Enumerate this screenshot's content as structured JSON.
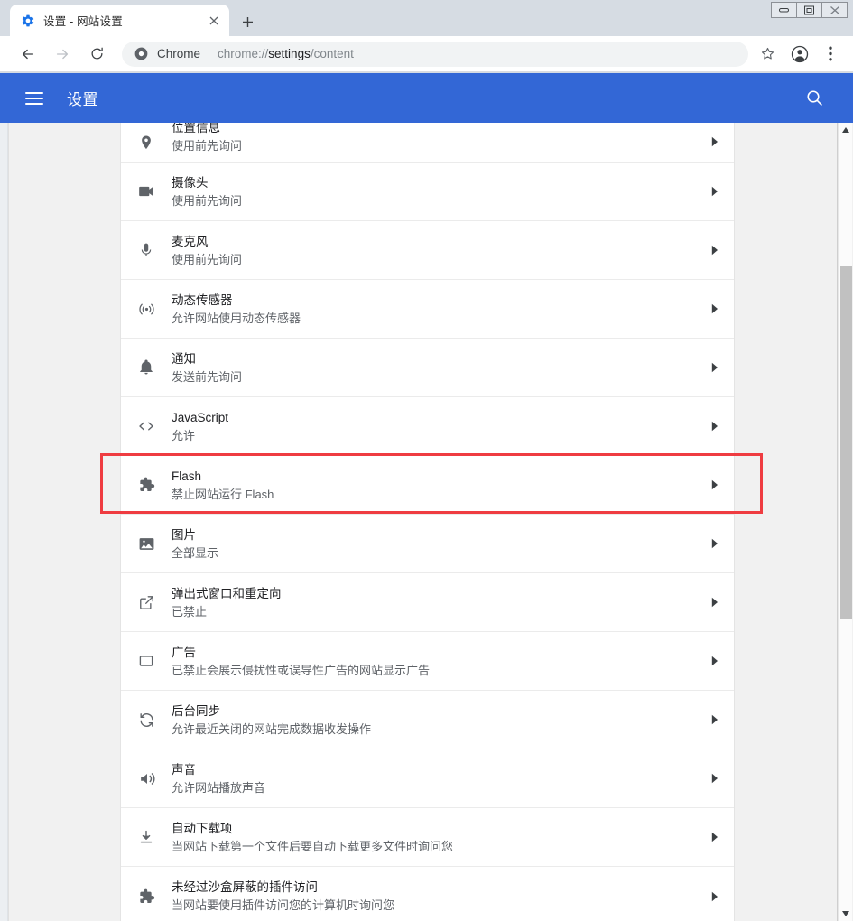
{
  "window": {
    "controls": [
      {
        "name": "minimize",
        "label": "—"
      },
      {
        "name": "maximize",
        "label": "❐"
      },
      {
        "name": "close",
        "label": "✕"
      }
    ]
  },
  "tabstrip": {
    "tab": {
      "favicon": "gear-icon",
      "title": "设置 - 网站设置",
      "close_label": "✕"
    },
    "new_tab_label": "+"
  },
  "toolbar": {
    "back_icon": "back-arrow-icon",
    "forward_icon": "forward-arrow-icon",
    "reload_icon": "reload-icon",
    "omnibox": {
      "security_icon": "chrome-logo-icon",
      "scheme_label": "Chrome",
      "url_prefix": "chrome://",
      "url_highlight": "settings",
      "url_suffix": "/content",
      "full_url": "chrome://settings/content"
    },
    "star_icon": "star-icon",
    "profile_icon": "profile-avatar-icon",
    "menu_icon": "three-dot-menu-icon"
  },
  "settings_header": {
    "menu_icon": "hamburger-menu-icon",
    "title": "设置",
    "search_icon": "search-icon",
    "background_color": "#3367d6"
  },
  "annotation": {
    "highlight_color": "#ef3c41",
    "target_row": "Flash"
  },
  "content": {
    "rows": [
      {
        "icon": "location-pin-icon",
        "title": "位置信息",
        "subtitle": "使用前先询问",
        "arrow": "chevron-right-icon",
        "clipped": "top"
      },
      {
        "icon": "video-camera-icon",
        "title": "摄像头",
        "subtitle": "使用前先询问",
        "arrow": "chevron-right-icon"
      },
      {
        "icon": "microphone-icon",
        "title": "麦克风",
        "subtitle": "使用前先询问",
        "arrow": "chevron-right-icon"
      },
      {
        "icon": "motion-sensor-icon",
        "title": "动态传感器",
        "subtitle": "允许网站使用动态传感器",
        "arrow": "chevron-right-icon"
      },
      {
        "icon": "bell-icon",
        "title": "通知",
        "subtitle": "发送前先询问",
        "arrow": "chevron-right-icon"
      },
      {
        "icon": "code-brackets-icon",
        "title": "JavaScript",
        "subtitle": "允许",
        "arrow": "chevron-right-icon"
      },
      {
        "icon": "puzzle-piece-icon",
        "title": "Flash",
        "subtitle": "禁止网站运行 Flash",
        "arrow": "chevron-right-icon",
        "highlighted": true
      },
      {
        "icon": "image-icon",
        "title": "图片",
        "subtitle": "全部显示",
        "arrow": "chevron-right-icon"
      },
      {
        "icon": "popup-window-icon",
        "title": "弹出式窗口和重定向",
        "subtitle": "已禁止",
        "arrow": "chevron-right-icon"
      },
      {
        "icon": "ads-rectangle-icon",
        "title": "广告",
        "subtitle": "已禁止会展示侵扰性或误导性广告的网站显示广告",
        "arrow": "chevron-right-icon"
      },
      {
        "icon": "sync-icon",
        "title": "后台同步",
        "subtitle": "允许最近关闭的网站完成数据收发操作",
        "arrow": "chevron-right-icon"
      },
      {
        "icon": "speaker-icon",
        "title": "声音",
        "subtitle": "允许网站播放声音",
        "arrow": "chevron-right-icon"
      },
      {
        "icon": "download-icon",
        "title": "自动下载项",
        "subtitle": "当网站下载第一个文件后要自动下载更多文件时询问您",
        "arrow": "chevron-right-icon"
      },
      {
        "icon": "puzzle-piece-icon",
        "title": "未经过沙盒屏蔽的插件访问",
        "subtitle": "当网站要使用插件访问您的计算机时询问您",
        "arrow": "chevron-right-icon",
        "clipped": "bottom"
      }
    ]
  },
  "scrollbar": {
    "up_arrow": "scroll-up-arrow-icon",
    "down_arrow": "scroll-down-arrow-icon"
  }
}
